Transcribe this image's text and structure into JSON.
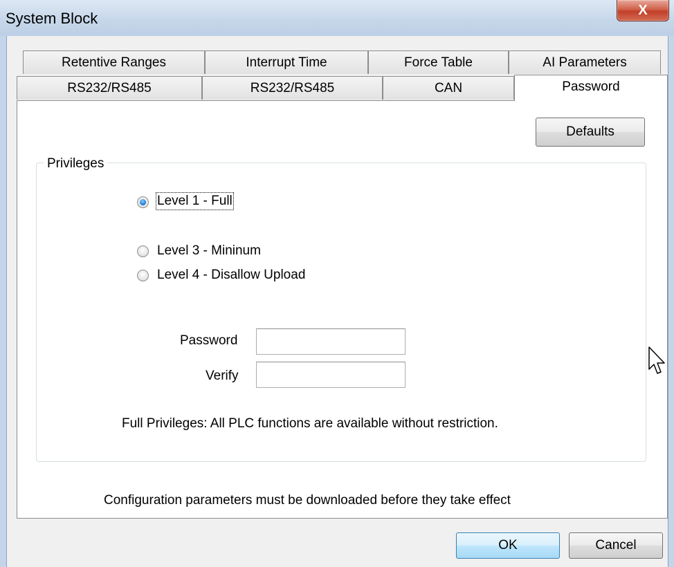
{
  "window": {
    "title": "System Block",
    "close_glyph": "X"
  },
  "tabs_row1": [
    {
      "label": "Retentive Ranges"
    },
    {
      "label": "Interrupt Time"
    },
    {
      "label": "Force Table"
    },
    {
      "label": "AI Parameters"
    }
  ],
  "tabs_row2": [
    {
      "label": "RS232/RS485"
    },
    {
      "label": "RS232/RS485"
    },
    {
      "label": "CAN"
    },
    {
      "label": "Password",
      "active": true
    }
  ],
  "panel": {
    "defaults_button": "Defaults",
    "privileges_group": "Privileges",
    "radio_options": [
      {
        "label": "Level 1 - Full",
        "checked": true
      },
      {
        "label": "Level 3 - Mininum",
        "checked": false
      },
      {
        "label": "Level 4 - Disallow Upload",
        "checked": false
      }
    ],
    "password_label": "Password",
    "password_value": "",
    "verify_label": "Verify",
    "verify_value": "",
    "description": "Full Privileges: All PLC functions are available without restriction.",
    "note": "Configuration parameters must be downloaded before they take effect"
  },
  "footer": {
    "ok_button": "OK",
    "cancel_button": "Cancel"
  },
  "icons": {
    "close": "close-icon",
    "cursor": "mouse-pointer-icon",
    "radio": "radio-button-icon"
  },
  "colors": {
    "titlebar": "#c7d7ea",
    "close_button": "#c2402a",
    "default_button_border": "#3c7fb1",
    "radio_selected": "#1e7fd8"
  }
}
